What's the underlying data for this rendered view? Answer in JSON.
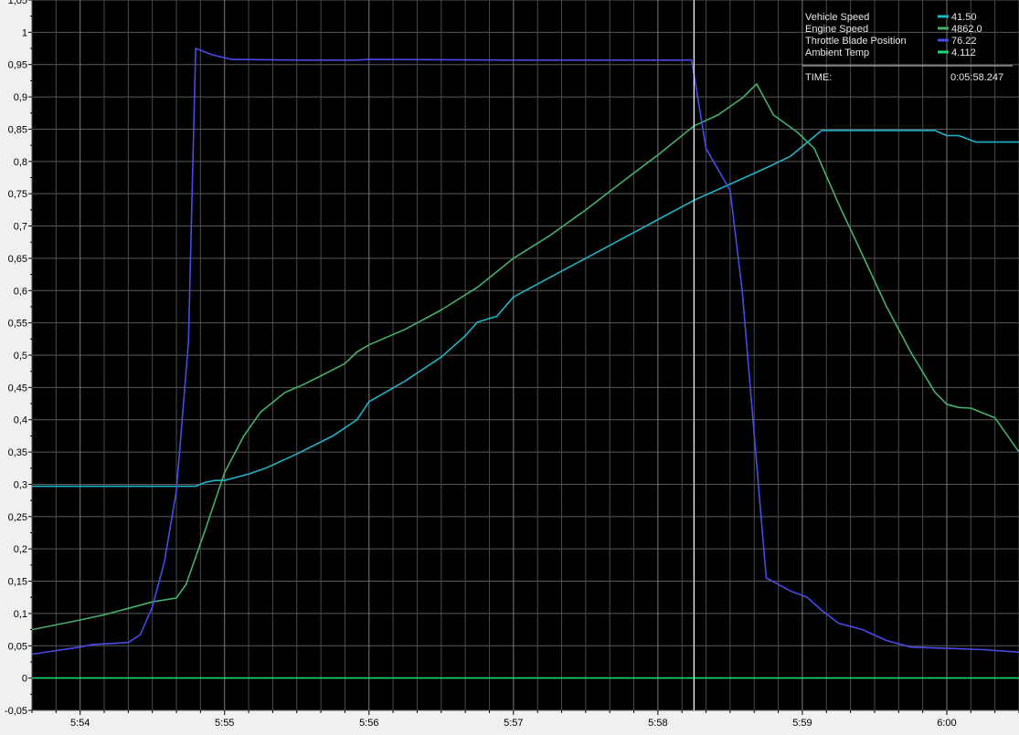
{
  "chart_data": {
    "type": "line",
    "xlim": [
      "5:53:40",
      "6:00:30"
    ],
    "ylim": [
      -0.05,
      1.05
    ],
    "grid": true,
    "legend_placement": "top-right",
    "x_ticks": [
      "5:54",
      "5:55",
      "5:56",
      "5:57",
      "5:58",
      "5:59",
      "6:00"
    ],
    "y_ticks": [
      "1,05",
      "1",
      "0,95",
      "0,9",
      "0,85",
      "0,8",
      "0,75",
      "0,7",
      "0,65",
      "0,6",
      "0,55",
      "0,5",
      "0,45",
      "0,4",
      "0,35",
      "0,3",
      "0,25",
      "0,2",
      "0,15",
      "0,1",
      "0,05",
      "0",
      "-0,05"
    ],
    "cursor_time": "5:58:15",
    "legend": {
      "entries": [
        {
          "name": "Vehicle Speed",
          "value": "41.50",
          "color": "#1fb3c8"
        },
        {
          "name": "Engine Speed",
          "value": "4862.0",
          "color": "#44b06c"
        },
        {
          "name": "Throttle Blade Position",
          "value": "76.22",
          "color": "#4a4ae8"
        },
        {
          "name": "Ambient Temp",
          "value": "4.112",
          "color": "#18d870"
        }
      ],
      "time_label": "TIME:",
      "time_value": "0:05:58.247"
    },
    "series": [
      {
        "name": "Vehicle Speed",
        "color": "#1fb3c8",
        "points": [
          [
            "5:53:40",
            0.297
          ],
          [
            "5:54:48",
            0.297
          ],
          [
            "5:54:52",
            0.303
          ],
          [
            "5:54:56",
            0.306
          ],
          [
            "5:55:00",
            0.306
          ],
          [
            "5:55:10",
            0.316
          ],
          [
            "5:55:17",
            0.325
          ],
          [
            "5:55:30",
            0.347
          ],
          [
            "5:55:45",
            0.375
          ],
          [
            "5:55:55",
            0.4
          ],
          [
            "5:56:00",
            0.428
          ],
          [
            "5:56:15",
            0.46
          ],
          [
            "5:56:30",
            0.497
          ],
          [
            "5:56:40",
            0.53
          ],
          [
            "5:56:45",
            0.551
          ],
          [
            "5:56:50",
            0.557
          ],
          [
            "5:56:53",
            0.56
          ],
          [
            "5:57:00",
            0.59
          ],
          [
            "5:57:15",
            0.62
          ],
          [
            "5:57:30",
            0.65
          ],
          [
            "5:57:45",
            0.68
          ],
          [
            "5:58:00",
            0.71
          ],
          [
            "5:58:15",
            0.74
          ],
          [
            "5:58:30",
            0.765
          ],
          [
            "5:58:45",
            0.79
          ],
          [
            "5:58:55",
            0.808
          ],
          [
            "5:59:08",
            0.848
          ],
          [
            "5:59:55",
            0.848
          ],
          [
            "6:00:00",
            0.84
          ],
          [
            "6:00:05",
            0.84
          ],
          [
            "6:00:12",
            0.83
          ],
          [
            "6:00:30",
            0.83
          ]
        ]
      },
      {
        "name": "Engine Speed",
        "color": "#44b06c",
        "points": [
          [
            "5:53:40",
            0.075
          ],
          [
            "5:54:00",
            0.09
          ],
          [
            "5:54:10",
            0.098
          ],
          [
            "5:54:20",
            0.108
          ],
          [
            "5:54:30",
            0.118
          ],
          [
            "5:54:40",
            0.124
          ],
          [
            "5:54:44",
            0.145
          ],
          [
            "5:54:52",
            0.23
          ],
          [
            "5:55:00",
            0.318
          ],
          [
            "5:55:08",
            0.375
          ],
          [
            "5:55:15",
            0.412
          ],
          [
            "5:55:25",
            0.442
          ],
          [
            "5:55:33",
            0.455
          ],
          [
            "5:55:40",
            0.468
          ],
          [
            "5:55:50",
            0.487
          ],
          [
            "5:55:55",
            0.505
          ],
          [
            "5:56:00",
            0.516
          ],
          [
            "5:56:15",
            0.54
          ],
          [
            "5:56:30",
            0.57
          ],
          [
            "5:56:45",
            0.605
          ],
          [
            "5:57:00",
            0.65
          ],
          [
            "5:57:15",
            0.685
          ],
          [
            "5:57:30",
            0.725
          ],
          [
            "5:57:45",
            0.768
          ],
          [
            "5:58:00",
            0.81
          ],
          [
            "5:58:15",
            0.855
          ],
          [
            "5:58:25",
            0.872
          ],
          [
            "5:58:35",
            0.898
          ],
          [
            "5:58:41",
            0.92
          ],
          [
            "5:58:48",
            0.872
          ],
          [
            "5:58:58",
            0.845
          ],
          [
            "5:59:05",
            0.82
          ],
          [
            "5:59:15",
            0.735
          ],
          [
            "5:59:25",
            0.655
          ],
          [
            "5:59:35",
            0.575
          ],
          [
            "5:59:45",
            0.505
          ],
          [
            "5:59:55",
            0.443
          ],
          [
            "6:00:00",
            0.424
          ],
          [
            "6:00:05",
            0.419
          ],
          [
            "6:00:10",
            0.418
          ],
          [
            "6:00:20",
            0.403
          ],
          [
            "6:00:30",
            0.35
          ]
        ]
      },
      {
        "name": "Throttle Blade Position",
        "color": "#4a4ae8",
        "points": [
          [
            "5:53:40",
            0.037
          ],
          [
            "5:54:00",
            0.048
          ],
          [
            "5:54:05",
            0.052
          ],
          [
            "5:54:15",
            0.054
          ],
          [
            "5:54:20",
            0.055
          ],
          [
            "5:54:25",
            0.067
          ],
          [
            "5:54:30",
            0.11
          ],
          [
            "5:54:35",
            0.18
          ],
          [
            "5:54:40",
            0.29
          ],
          [
            "5:54:45",
            0.52
          ],
          [
            "5:54:48",
            0.975
          ],
          [
            "5:54:55",
            0.965
          ],
          [
            "5:55:03",
            0.958
          ],
          [
            "5:55:30",
            0.957
          ],
          [
            "5:55:55",
            0.957
          ],
          [
            "5:56:00",
            0.958
          ],
          [
            "5:57:00",
            0.957
          ],
          [
            "5:58:14",
            0.957
          ],
          [
            "5:58:20",
            0.82
          ],
          [
            "5:58:30",
            0.755
          ],
          [
            "5:58:35",
            0.6
          ],
          [
            "5:58:45",
            0.155
          ],
          [
            "5:58:55",
            0.135
          ],
          [
            "5:59:02",
            0.125
          ],
          [
            "5:59:08",
            0.105
          ],
          [
            "5:59:15",
            0.085
          ],
          [
            "5:59:25",
            0.075
          ],
          [
            "5:59:35",
            0.058
          ],
          [
            "5:59:45",
            0.048
          ],
          [
            "6:00:00",
            0.046
          ],
          [
            "6:00:15",
            0.044
          ],
          [
            "6:00:30",
            0.04
          ]
        ]
      },
      {
        "name": "Ambient Temp",
        "color": "#18d870",
        "points": [
          [
            "5:53:40",
            0.0
          ],
          [
            "6:00:30",
            0.0
          ]
        ]
      }
    ]
  }
}
